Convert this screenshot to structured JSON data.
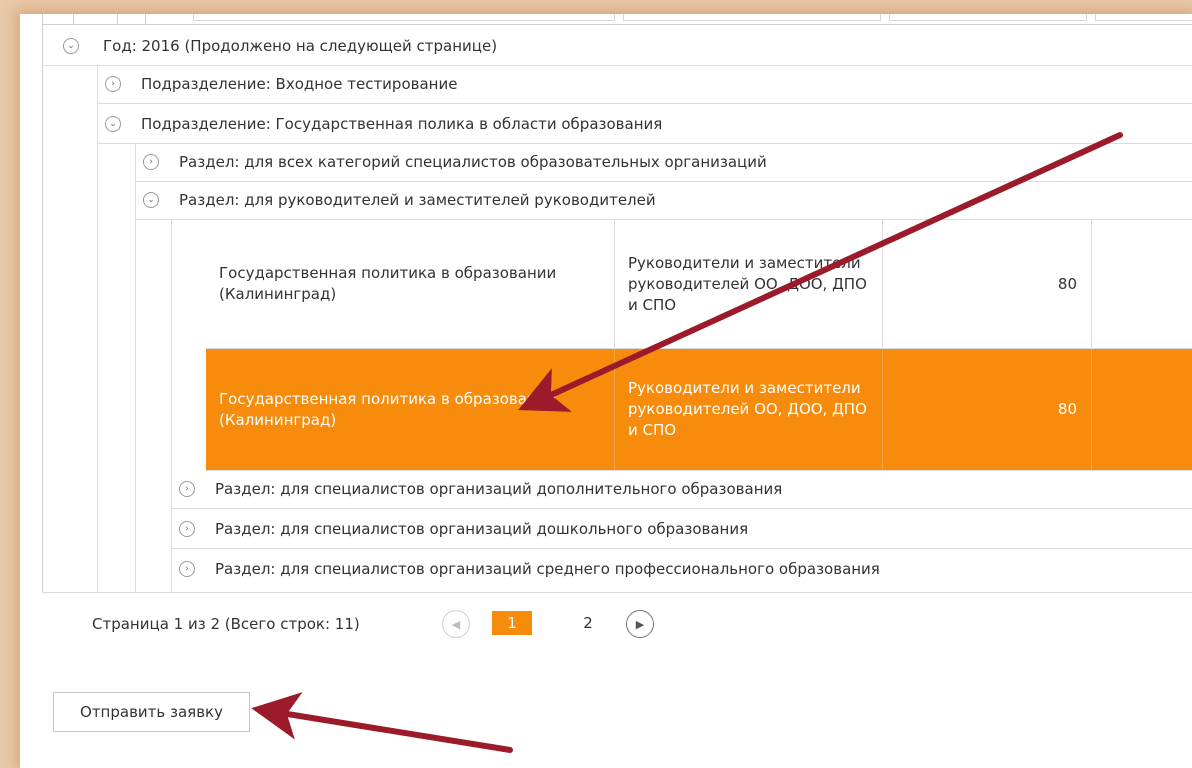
{
  "groups": {
    "year": "Год: 2016 (Продолжено на следующей странице)",
    "sub_input": "Подразделение: Входное тестирование",
    "sub_policy": "Подразделение: Государственная полика в области образования",
    "sec_all": "Раздел: для всех категорий специалистов образовательных организаций",
    "sec_heads": "Раздел: для руководителей и заместителей руководителей",
    "sec_addl": "Раздел: для специалистов организаций дополнительного образования",
    "sec_preschool": "Раздел: для специалистов организаций дошкольного образования",
    "sec_prof": "Раздел: для специалистов организаций среднего профессионального образования"
  },
  "rows": [
    {
      "name": "Государственная политика в образовании (Калининград)",
      "audience": "Руководители и заместители руководителей ОО, ДОО, ДПО и СПО",
      "hours": "80"
    },
    {
      "name": "Государственная политика в образовании (Калининград)",
      "audience": "Руководители и заместители руководителей ОО, ДОО, ДПО и СПО",
      "hours": "80"
    }
  ],
  "pager": {
    "info": "Страница 1 из 2 (Всего строк: 11)",
    "page1": "1",
    "page2": "2"
  },
  "submit_label": "Отправить заявку",
  "colors": {
    "accent": "#f68b0c",
    "arrow": "#9b1b2a"
  }
}
